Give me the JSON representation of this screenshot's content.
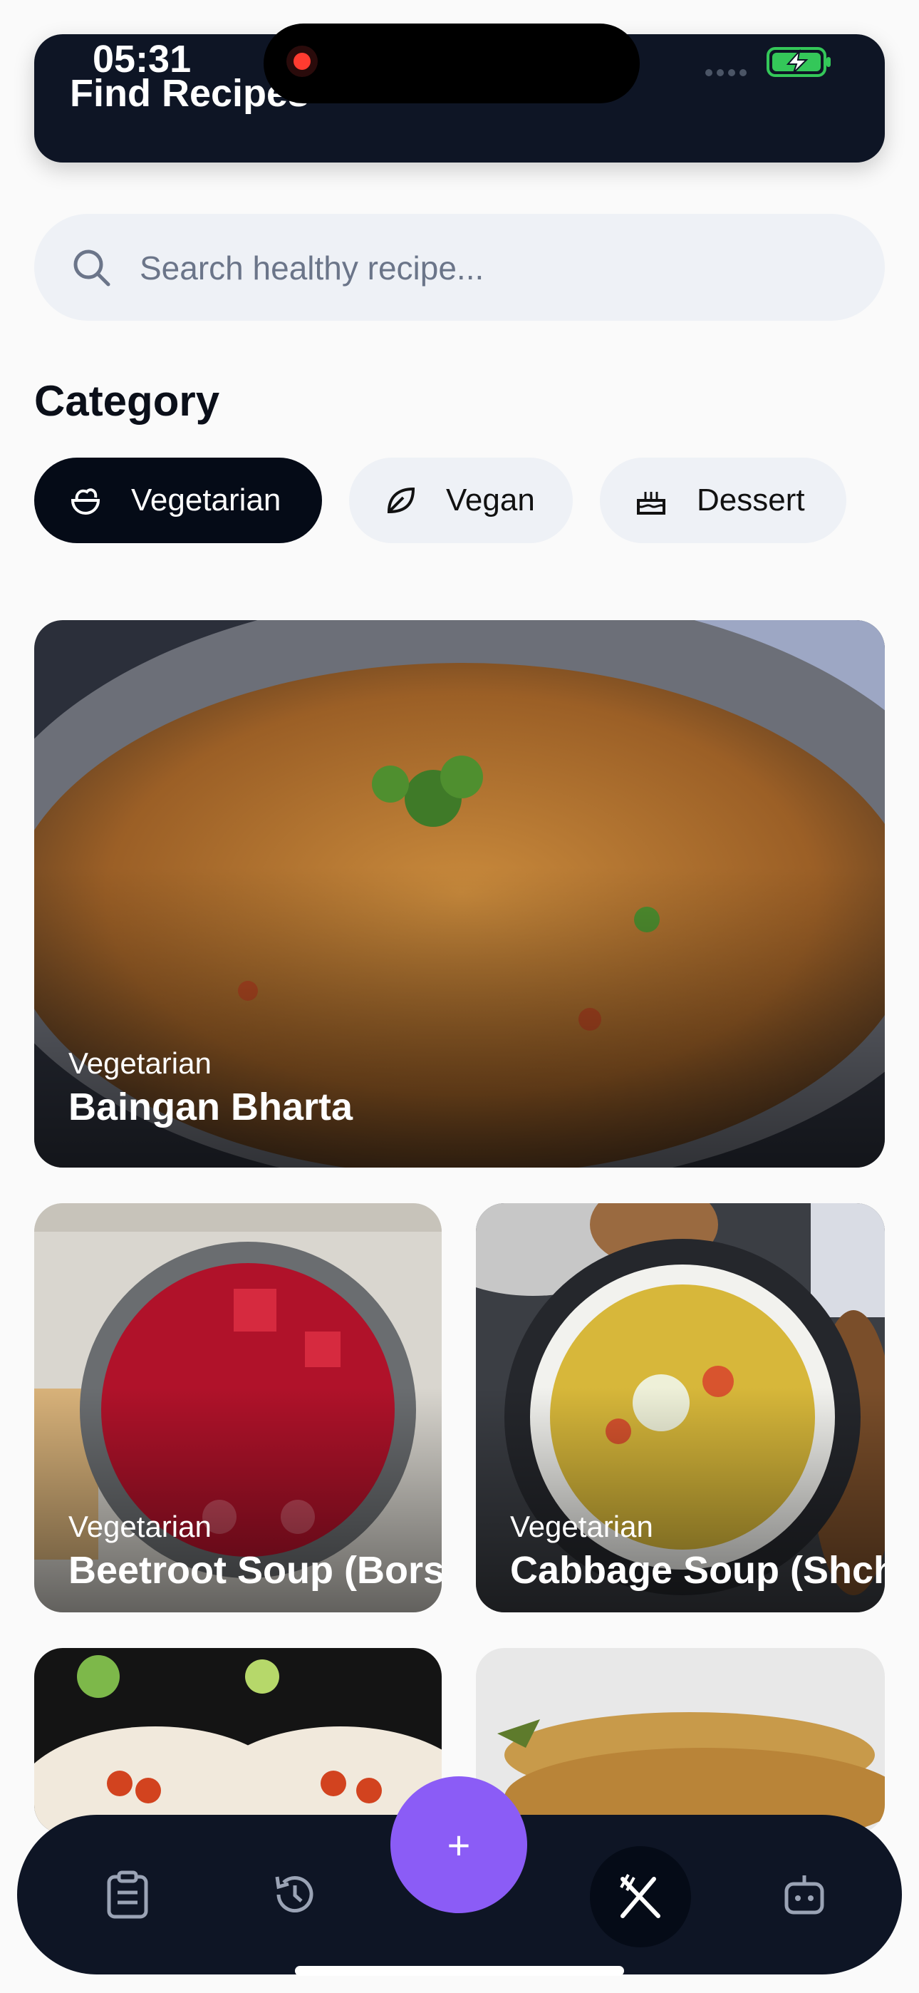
{
  "status_bar": {
    "time": "05:31"
  },
  "header": {
    "title": "Find Recipes"
  },
  "search": {
    "placeholder": "Search healthy recipe..."
  },
  "category": {
    "title": "Category",
    "chips": [
      {
        "label": "Vegetarian",
        "icon": "salad-bowl-icon",
        "active": true
      },
      {
        "label": "Vegan",
        "icon": "leaf-icon",
        "active": false
      },
      {
        "label": "Dessert",
        "icon": "cake-icon",
        "active": false
      }
    ]
  },
  "recipes": [
    {
      "category": "Vegetarian",
      "name": "Baingan Bharta"
    },
    {
      "category": "Vegetarian",
      "name": "Beetroot Soup (Borscht)"
    },
    {
      "category": "Vegetarian",
      "name": "Cabbage Soup (Shchi)"
    }
  ],
  "fab": {
    "label": "+"
  },
  "bottom_nav": [
    "clipboard-icon",
    "history-icon",
    "add-button",
    "recipes-icon",
    "robot-icon"
  ],
  "colors": {
    "dark": "#0e1525",
    "accent": "#8b5cf6",
    "chip_bg": "#eef1f6"
  }
}
